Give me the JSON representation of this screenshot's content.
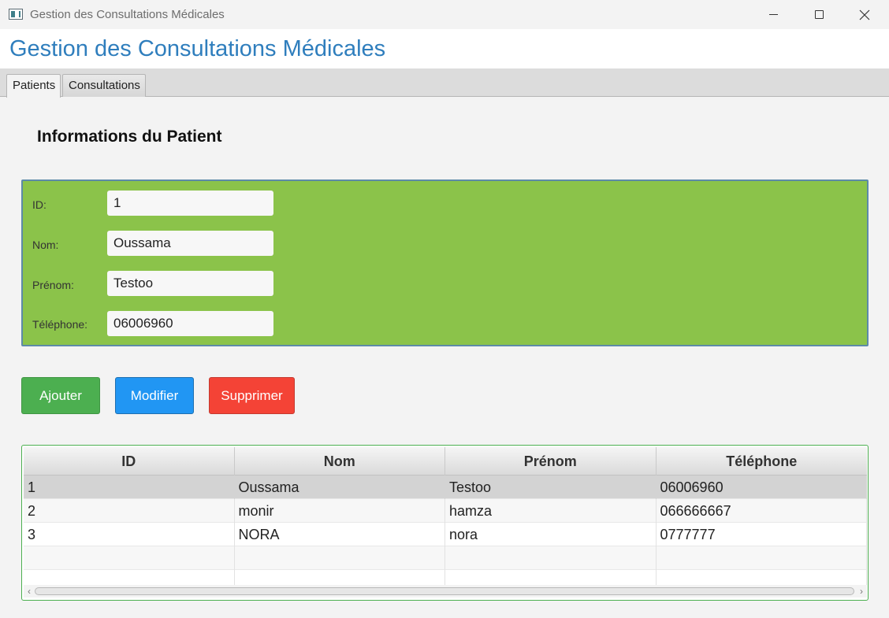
{
  "window": {
    "title": "Gestion des Consultations Médicales"
  },
  "header": {
    "title": "Gestion des Consultations Médicales",
    "title_color": "#2f7ebd"
  },
  "tabs": [
    {
      "label": "Patients",
      "selected": true
    },
    {
      "label": "Consultations",
      "selected": false
    }
  ],
  "form": {
    "section_title": "Informations du Patient",
    "panel_color": "#8bc34a",
    "fields": [
      {
        "label": "ID:",
        "value": "1"
      },
      {
        "label": "Nom:",
        "value": "Oussama"
      },
      {
        "label": "Prénom:",
        "value": "Testoo"
      },
      {
        "label": "Téléphone:",
        "value": "06006960"
      }
    ]
  },
  "actions": {
    "add_label": "Ajouter",
    "edit_label": "Modifier",
    "delete_label": "Supprimer",
    "add_color": "#4caf50",
    "edit_color": "#2196f3",
    "delete_color": "#f44336"
  },
  "table": {
    "columns": [
      "ID",
      "Nom",
      "Prénom",
      "Téléphone"
    ],
    "rows": [
      [
        "1",
        "Oussama",
        "Testoo",
        "06006960"
      ],
      [
        "2",
        "monir",
        "hamza",
        "066666667"
      ],
      [
        "3",
        "NORA",
        "nora",
        "0777777"
      ]
    ],
    "selected_row": 0
  },
  "icons": {
    "minimize": "minimize-icon",
    "maximize": "maximize-icon",
    "close": "close-icon",
    "scroll_left": "chevron-left-icon",
    "scroll_right": "chevron-right-icon"
  }
}
